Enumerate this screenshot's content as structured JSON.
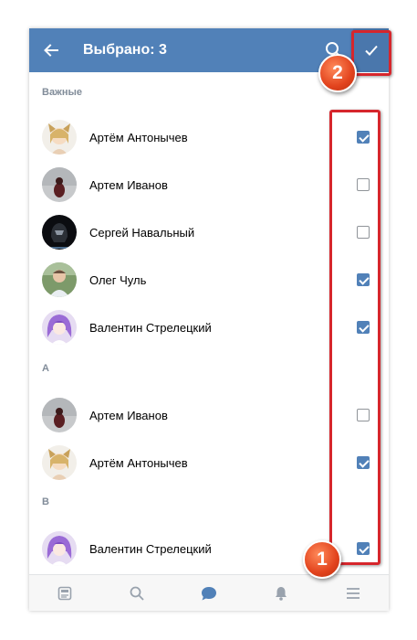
{
  "header": {
    "title": "Выбрано: 3"
  },
  "colors": {
    "accent": "#5181b8",
    "annotation": "#d6262c",
    "badge": "#e2431d"
  },
  "sections": [
    {
      "label": "Важные",
      "items": [
        {
          "name": "Артём Антонычев",
          "checked": true,
          "avatar": "girl-cat-ears-avatar"
        },
        {
          "name": "Артем Иванов",
          "checked": false,
          "avatar": "grey-figure-avatar"
        },
        {
          "name": "Сергей Навальный",
          "checked": false,
          "avatar": "dark-helmet-avatar"
        },
        {
          "name": "Олег Чуль",
          "checked": true,
          "avatar": "man-photo-avatar"
        },
        {
          "name": "Валентин Стрелецкий",
          "checked": true,
          "avatar": "purple-anime-avatar"
        }
      ]
    },
    {
      "label": "А",
      "items": [
        {
          "name": "Артем Иванов",
          "checked": false,
          "avatar": "grey-figure-avatar"
        },
        {
          "name": "Артём Антонычев",
          "checked": true,
          "avatar": "girl-cat-ears-avatar"
        }
      ]
    },
    {
      "label": "В",
      "items": [
        {
          "name": "Валентин Стрелецкий",
          "checked": true,
          "avatar": "purple-anime-avatar"
        }
      ]
    }
  ],
  "tabbar": {
    "tabs": [
      {
        "icon": "news-icon",
        "active": false
      },
      {
        "icon": "search-icon",
        "active": false
      },
      {
        "icon": "messages-icon",
        "active": true
      },
      {
        "icon": "notifications-icon",
        "active": false
      },
      {
        "icon": "menu-icon",
        "active": false
      }
    ]
  },
  "annotations": {
    "badge_1": "1",
    "badge_2": "2"
  }
}
